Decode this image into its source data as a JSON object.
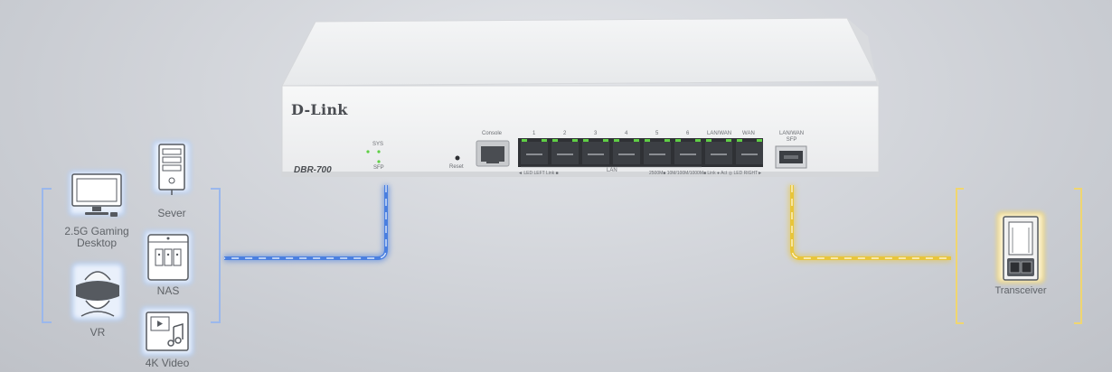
{
  "device": {
    "brand": "D-Link",
    "model": "DBR-700",
    "console_label": "Console",
    "reset_label": "Reset",
    "sys_label": "SYS",
    "sfp_led_label": "SFP",
    "port_numbers": [
      "1",
      "2",
      "3",
      "4",
      "5",
      "6",
      "LAN/WAN",
      "WAN"
    ],
    "sfp_port_label": "LAN/WAN\nSFP",
    "lan_label": "LAN",
    "led_legend_left": "◄ LED LEFT  Link ■",
    "led_legend_right": "2500M■ 10M/100M/1000M■  Link ● Act ◎  LED RIGHT►"
  },
  "devices": {
    "gaming_desktop": "2.5G Gaming\nDesktop",
    "server": "Sever",
    "nas": "NAS",
    "vr": "VR",
    "video": "4K Video",
    "transceiver": "Transceiver"
  },
  "colors": {
    "blue_cable": "#4a7fe0",
    "yellow_cable": "#e8c53a",
    "bracket_blue": "#9bb8ec",
    "bracket_yellow": "#f0d670",
    "led_green": "#5fcf45",
    "port_dark": "#3c3f44"
  },
  "icons": [
    "monitor-icon",
    "tower-server-icon",
    "nas-icon",
    "vr-headset-icon",
    "video-file-icon",
    "sfp-transceiver-icon"
  ]
}
